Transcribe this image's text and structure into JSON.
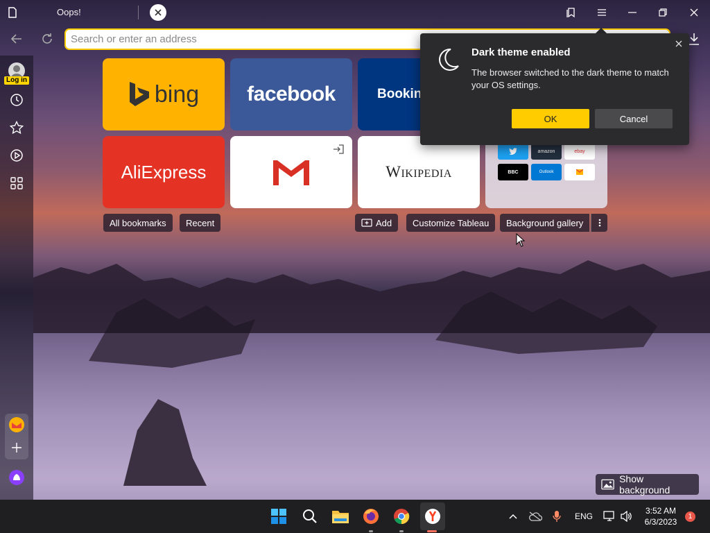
{
  "tab": {
    "title": "Oops!"
  },
  "address": {
    "placeholder": "Search or enter an address"
  },
  "sidebar": {
    "login_label": "Log in"
  },
  "tiles": [
    {
      "name": "bing",
      "label": "bing",
      "bg": "#ffb300"
    },
    {
      "name": "facebook",
      "label": "facebook",
      "bg": "#3b5998"
    },
    {
      "name": "booking",
      "label": "Bookin",
      "bg": "#003580"
    },
    {
      "name": "aliexpress",
      "label": "AliExpress",
      "bg": "#e43225"
    },
    {
      "name": "gmail",
      "label": "",
      "bg": "#ffffff"
    },
    {
      "name": "wikipedia",
      "label": "Wikipedia",
      "bg": "#ffffff"
    }
  ],
  "mini_tiles": [
    {
      "label": "",
      "bg": "#1da1f2"
    },
    {
      "label": "amazon",
      "bg": "#232f3e"
    },
    {
      "label": "ebay",
      "bg": "#ffffff"
    },
    {
      "label": "BBC",
      "bg": "#000000"
    },
    {
      "label": "Outlook",
      "bg": "#0078d4"
    },
    {
      "label": "",
      "bg": "#ffffff"
    }
  ],
  "toolbar": {
    "all_bookmarks": "All bookmarks",
    "recent": "Recent",
    "add": "Add",
    "customize": "Customize Tableau",
    "background_gallery": "Background gallery"
  },
  "popup": {
    "title": "Dark theme enabled",
    "text": "The browser switched to the dark theme to match your OS settings.",
    "ok": "OK",
    "cancel": "Cancel"
  },
  "show_background": "Show background",
  "taskbar": {
    "language": "ENG",
    "time": "3:52 AM",
    "date": "6/3/2023",
    "notification_count": "1"
  },
  "colors": {
    "accent": "#ffcc00",
    "popup_bg": "#2b2b2d"
  }
}
